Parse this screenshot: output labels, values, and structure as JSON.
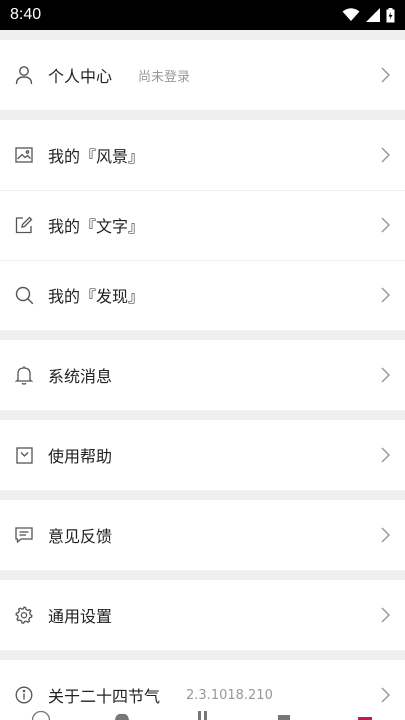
{
  "status_bar": {
    "time": "8:40"
  },
  "profile": {
    "label": "个人中心",
    "status": "尚未登录"
  },
  "gallery": [
    {
      "label": "我的『风景』",
      "icon": "image-icon"
    },
    {
      "label": "我的『文字』",
      "icon": "edit-icon"
    },
    {
      "label": "我的『发现』",
      "icon": "search-icon"
    }
  ],
  "notifications": {
    "label": "系统消息",
    "icon": "bell-icon"
  },
  "help": {
    "label": "使用帮助",
    "icon": "help-box-icon"
  },
  "feedback": {
    "label": "意见反馈",
    "icon": "message-icon"
  },
  "settings": {
    "label": "通用设置",
    "icon": "gear-icon"
  },
  "about": {
    "label": "关于二十四节气",
    "version": "2.3.1018.210",
    "icon": "info-icon"
  },
  "colors": {
    "accent": "#c2185b",
    "divider": "#eeeeee",
    "background": "#efefef"
  }
}
